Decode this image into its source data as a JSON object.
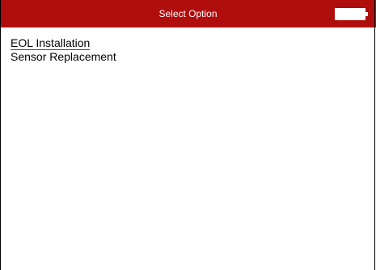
{
  "header": {
    "title": "Select Option",
    "battery_icon": "battery-icon",
    "battery_level": 1.0,
    "colors": {
      "bar": "#b00d0d",
      "text": "#ffffff"
    }
  },
  "menu": {
    "items": [
      {
        "label": "EOL Installation",
        "selected": true
      },
      {
        "label": "Sensor Replacement",
        "selected": false
      }
    ],
    "selection_underline_color": "#c01010"
  }
}
